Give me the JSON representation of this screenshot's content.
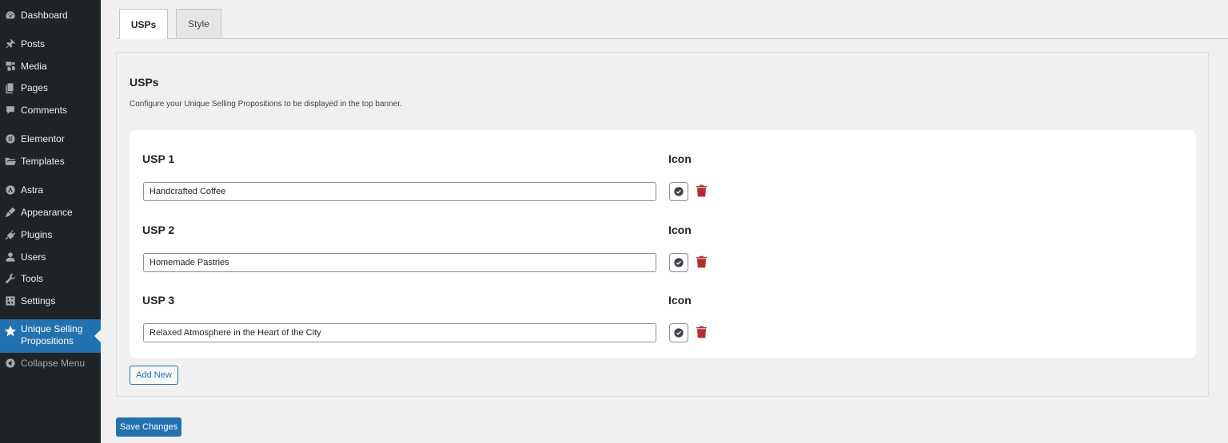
{
  "sidebar": {
    "items": [
      {
        "label": "Dashboard",
        "icon": "dashboard-icon"
      },
      {
        "label": "Posts",
        "icon": "pin-icon"
      },
      {
        "label": "Media",
        "icon": "media-icon"
      },
      {
        "label": "Pages",
        "icon": "pages-icon"
      },
      {
        "label": "Comments",
        "icon": "comment-icon"
      },
      {
        "label": "Elementor",
        "icon": "elementor-icon"
      },
      {
        "label": "Templates",
        "icon": "folder-icon"
      },
      {
        "label": "Astra",
        "icon": "astra-icon"
      },
      {
        "label": "Appearance",
        "icon": "brush-icon"
      },
      {
        "label": "Plugins",
        "icon": "plug-icon"
      },
      {
        "label": "Users",
        "icon": "user-icon"
      },
      {
        "label": "Tools",
        "icon": "wrench-icon"
      },
      {
        "label": "Settings",
        "icon": "settings-icon"
      },
      {
        "label": "Unique Selling Propositions",
        "icon": "star-icon",
        "active": true
      },
      {
        "label": "Collapse Menu",
        "icon": "collapse-icon"
      }
    ]
  },
  "tabs": [
    {
      "label": "USPs",
      "active": true
    },
    {
      "label": "Style",
      "active": false
    }
  ],
  "panel": {
    "title": "USPs",
    "description": "Configure your Unique Selling Propositions to be displayed in the top banner."
  },
  "usps": [
    {
      "label": "USP 1",
      "icon_label": "Icon",
      "value": "Handcrafted Coffee",
      "icon": "check-circle-icon"
    },
    {
      "label": "USP 2",
      "icon_label": "Icon",
      "value": "Homemade Pastries",
      "icon": "check-circle-icon"
    },
    {
      "label": "USP 3",
      "icon_label": "Icon",
      "value": "Relaxed Atmosphere in the Heart of the City",
      "icon": "check-circle-icon"
    }
  ],
  "buttons": {
    "add_new": "Add New",
    "save_changes": "Save Changes"
  },
  "colors": {
    "sidebar_bg": "#1d2327",
    "accent": "#2271b1",
    "trash": "#b32d2e",
    "page_bg": "#f0f0f1"
  }
}
